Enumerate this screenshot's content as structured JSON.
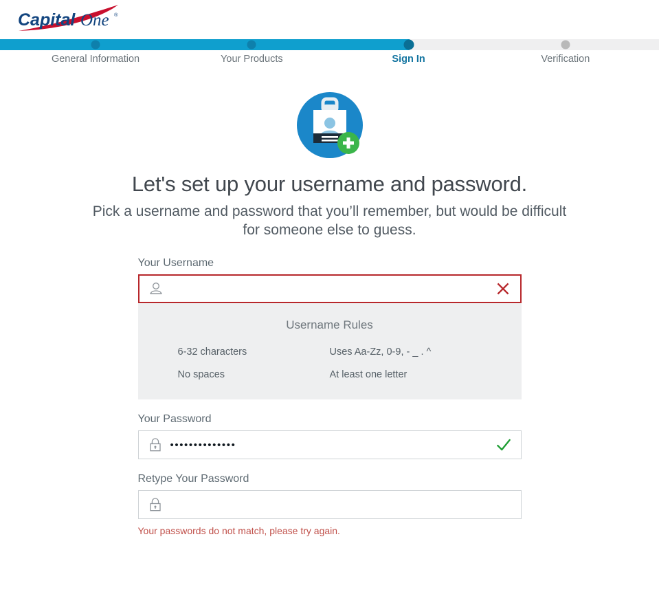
{
  "brand": {
    "logo_primary_text": "Capital",
    "logo_secondary_text": "One",
    "logo_trademark": "®",
    "navy": "#1a4480",
    "red": "#c8102e"
  },
  "progress": {
    "fill_percent": 62.2,
    "accent_color": "#0f9fce",
    "track_color": "#efeff0",
    "steps": [
      {
        "label": "General Information",
        "state": "done",
        "position_percent": 14.5
      },
      {
        "label": "Your Products",
        "state": "done",
        "position_percent": 38.2
      },
      {
        "label": "Sign In",
        "state": "current",
        "position_percent": 62.0
      },
      {
        "label": "Verification",
        "state": "upcoming",
        "position_percent": 85.8
      }
    ]
  },
  "hero": {
    "icon_name": "id-badge-add-icon",
    "circle_color": "#1b87c9",
    "badge_card_color": "#ffffff",
    "badge_person_color": "#8bc4e3",
    "badge_bar_color": "#1c2b39",
    "plus_circle_color": "#3bb54a"
  },
  "main": {
    "headline": "Let's set up your username and password.",
    "subhead": "Pick a username and password that you’ll remember, but would be difficult for someone else to guess."
  },
  "form": {
    "username": {
      "label": "Your Username",
      "value": "",
      "placeholder": "",
      "icon_name": "person-icon",
      "state": "error",
      "status_icon_name": "x-icon",
      "status_color": "#b7272b"
    },
    "rules": {
      "title": "Username Rules",
      "items": [
        "6-32 characters",
        "Uses Aa-Zz, 0-9, - _ . ^",
        "No spaces",
        "At least one letter"
      ]
    },
    "password": {
      "label": "Your Password",
      "value": "••••••••••••••",
      "placeholder": "",
      "icon_name": "lock-icon",
      "state": "valid",
      "status_icon_name": "check-icon",
      "status_color": "#1e9e33"
    },
    "retype_password": {
      "label": "Retype Your Password",
      "value": "",
      "placeholder": "",
      "icon_name": "lock-icon",
      "state": "error",
      "error_message": "Your passwords do not match, please try again.",
      "error_color": "#c0504a"
    }
  }
}
